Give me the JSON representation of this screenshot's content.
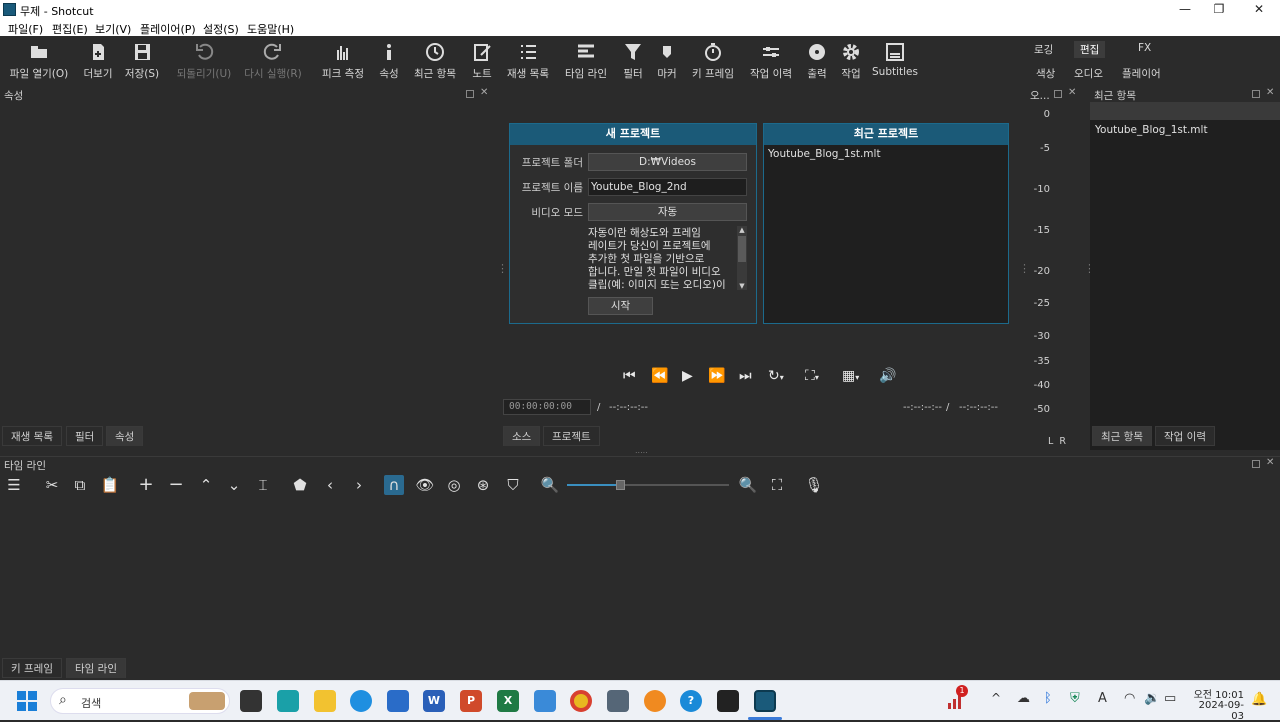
{
  "window": {
    "title": "무제 - Shotcut"
  },
  "menu": [
    "파일(F)",
    "편집(E)",
    "보기(V)",
    "플레이어(P)",
    "설정(S)",
    "도움말(H)"
  ],
  "toolbar": {
    "open": "파일 열기(O)",
    "more": "더보기",
    "save": "저장(S)",
    "undo": "되돌리기(U)",
    "redo": "다시 실행(R)",
    "peak": "피크 측정",
    "props": "속성",
    "recent": "최근 항목",
    "notes": "노트",
    "playlist": "재생 목록",
    "timeline": "타임 라인",
    "filters": "필터",
    "markers": "마커",
    "keyframes": "키 프레임",
    "jobs": "작업 이력",
    "export": "출력",
    "jobs2": "작업",
    "subtitles": "Subtitles"
  },
  "layouts": {
    "logging": "로깅",
    "editing": "편집",
    "fx": "FX",
    "color": "색상",
    "audio": "오디오",
    "player": "플레이어"
  },
  "properties_panel": {
    "title": "속성",
    "tabs": [
      "재생 목록",
      "필터",
      "속성"
    ]
  },
  "new_project": {
    "header": "새 프로젝트",
    "folder_label": "프로젝트 폴더",
    "folder_value": "D:₩Videos",
    "name_label": "프로젝트 이름",
    "name_value": "Youtube_Blog_2nd",
    "mode_label": "비디오 모드",
    "mode_value": "자동",
    "description": [
      "자동이란 해상도와 프레임",
      "레이트가 당신이 프로젝트에",
      "추가한 첫 파일을 기반으로",
      "합니다. 만일 첫 파일이 비디오",
      "클립(예: 이미지 또는 오디오)이"
    ],
    "start": "시작"
  },
  "recent_projects": {
    "header": "최근 프로젝트",
    "items": [
      "Youtube_Blog_1st.mlt"
    ]
  },
  "player": {
    "timecode": "00:00:00:00",
    "sep": "/",
    "duration": "--:--:--:--",
    "in": "--:--:--:--",
    "out": "--:--:--:--",
    "tabs": [
      "소스",
      "프로젝트"
    ]
  },
  "audio_meter": {
    "title": "오...",
    "scale": [
      "0",
      "-5",
      "-10",
      "-15",
      "-20",
      "-25",
      "-30",
      "-35",
      "-40",
      "-50"
    ],
    "lr": "L  R"
  },
  "recent_panel": {
    "title": "최근 항목",
    "items": [
      "Youtube_Blog_1st.mlt"
    ],
    "tabs": [
      "최근 항목",
      "작업 이력"
    ]
  },
  "timeline_panel": {
    "title": "타임 라인",
    "zoom_level": 0.33,
    "tabs": [
      "키 프레임",
      "타임 라인"
    ]
  },
  "taskbar": {
    "search": "검색",
    "time": "오전 10:01",
    "date": "2024-09-03",
    "badge": "1",
    "lang": "A"
  }
}
